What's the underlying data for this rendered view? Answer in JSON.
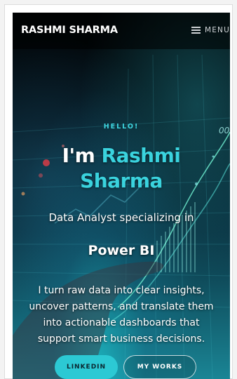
{
  "header": {
    "brand": "RASHMI SHARMA",
    "menu_label": "MENU"
  },
  "hero": {
    "greeting": "HELLO!",
    "headline_prefix": "I'm ",
    "headline_name_first": "Rashmi",
    "headline_name_last": "Sharma",
    "specialty": "Data Analyst specializing in",
    "tool": "Power BI",
    "bio_lines": [
      "I turn raw data into clear insights,",
      "uncover patterns, and translate them",
      "into actionable dashboards that",
      "support smart business decisions."
    ],
    "overlay_text": "00"
  },
  "buttons": {
    "linkedin": "LINKEDIN",
    "my_works": "MY WORKS"
  },
  "colors": {
    "accent": "#3ad3de",
    "button_fill": "#2cc9d4",
    "header_bg": "#000000"
  }
}
